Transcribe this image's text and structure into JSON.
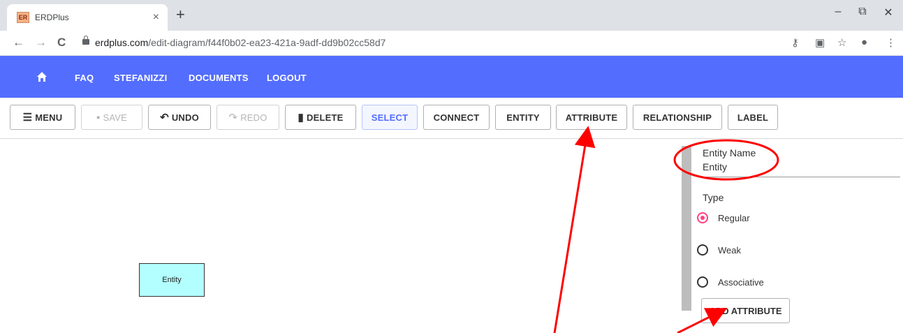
{
  "browser": {
    "tab_title": "ERDPlus",
    "favicon_text": "ER",
    "tab_close": "×",
    "new_tab": "+",
    "url_host": "erdplus.com",
    "url_path": "/edit-diagram/f44f0b02-ea23-421a-9adf-dd9b02cc58d7",
    "window_controls": {
      "minimize": "–",
      "restore": "⧉",
      "close": "✕"
    },
    "nav": {
      "back": "←",
      "forward": "→",
      "reload": "C"
    },
    "omnibox_icons": [
      "key-icon",
      "translate-icon",
      "star-icon",
      "account-icon",
      "more-icon"
    ]
  },
  "app_nav": {
    "links": [
      "FAQ",
      "STEFANIZZI",
      "DOCUMENTS",
      "LOGOUT"
    ],
    "background": "#536dfe"
  },
  "toolbar": {
    "menu": "MENU",
    "save": "SAVE",
    "undo": "UNDO",
    "redo": "REDO",
    "delete": "DELETE",
    "select": "SELECT",
    "connect": "CONNECT",
    "entity": "ENTITY",
    "attribute": "ATTRIBUTE",
    "relationship": "RELATIONSHIP",
    "label": "LABEL"
  },
  "canvas": {
    "entity_label": "Entity",
    "entity_fill": "#b3ffff"
  },
  "panel": {
    "name_label": "Entity Name",
    "name_value": "Entity",
    "type_label": "Type",
    "types": [
      {
        "label": "Regular",
        "checked": true
      },
      {
        "label": "Weak",
        "checked": false
      },
      {
        "label": "Associative",
        "checked": false
      }
    ],
    "add_attribute": "ADD ATTRIBUTE",
    "accent": "#ff4081"
  },
  "annotations": {
    "color": "#ff0000"
  }
}
